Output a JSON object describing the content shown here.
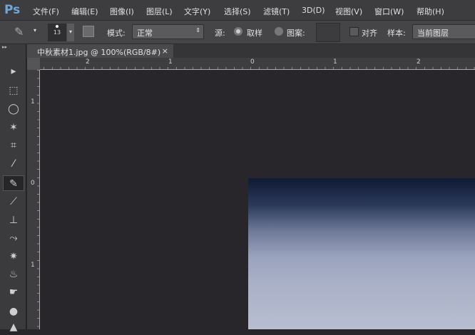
{
  "app": {
    "logo": "Ps"
  },
  "menu": [
    "文件(F)",
    "编辑(E)",
    "图像(I)",
    "图层(L)",
    "文字(Y)",
    "选择(S)",
    "滤镜(T)",
    "3D(D)",
    "视图(V)",
    "窗口(W)",
    "帮助(H)"
  ],
  "options": {
    "brush_size": "13",
    "mode_label": "模式:",
    "mode_value": "正常",
    "source_label": "源:",
    "sampled_label": "取样",
    "pattern_label": "图案:",
    "aligned_label": "对齐",
    "sample_label": "样本:",
    "sample_value": "当前图层"
  },
  "document": {
    "tab_title": "中秋素材1.jpg @ 100%(RGB/8#)",
    "close": "×"
  },
  "rulers": {
    "top": [
      "2",
      "1",
      "0",
      "1",
      "2"
    ],
    "left": [
      "1",
      "0",
      "1"
    ]
  },
  "tools": [
    "move-icon",
    "marquee-icon",
    "lasso-icon",
    "magic-wand-icon",
    "crop-icon",
    "eyedropper-icon",
    "healing-brush-icon",
    "brush-icon",
    "clone-stamp-icon",
    "history-brush-icon",
    "eraser-icon",
    "paint-bucket-icon",
    "smudge-icon",
    "sponge-icon",
    "pen-icon"
  ]
}
